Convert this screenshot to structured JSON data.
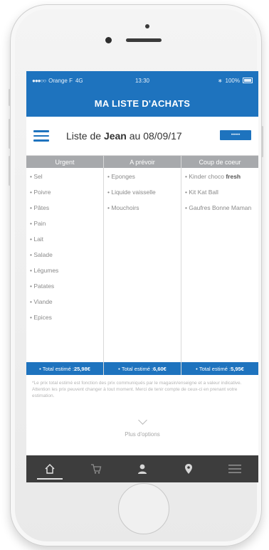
{
  "status": {
    "carrier": "Orange F",
    "network": "4G",
    "time": "13:30",
    "battery": "100%"
  },
  "app": {
    "title": "MA LISTE D'ACHATS"
  },
  "header": {
    "title_prefix": "Liste de ",
    "owner": "Jean",
    "title_suffix": " au 08/09/17",
    "chip_label": "••••••"
  },
  "columns": [
    {
      "heading": "Urgent",
      "items": [
        "Sel",
        "Poivre",
        "Pâtes",
        "Pain",
        "Lait",
        "Salade",
        "Légumes",
        "Patates",
        "Viande",
        "Epices"
      ],
      "total_label": "Total estimé : ",
      "total_value": "25,98€"
    },
    {
      "heading": "A prévoir",
      "items": [
        "Eponges",
        "Liquide vaisselle",
        "Mouchoirs"
      ],
      "total_label": "Total estimé : ",
      "total_value": "6,60€"
    },
    {
      "heading": "Coup de coeur",
      "items": [
        {
          "text": "Kinder choco ",
          "bold": "fresh"
        },
        {
          "text": "Kit Kat Ball",
          "bold": ""
        },
        {
          "text": "Gaufres Bonne Maman",
          "bold": ""
        }
      ],
      "total_label": "Total estimé : ",
      "total_value": "5,95€"
    }
  ],
  "note": "*Le prix total estimé est fonction des prix communiqués par le magasin/enseigne et a valeur indicative. Attention les prix peuvent changer à tout moment. Merci de tenir compte de ceux-ci en prenant votre estimation.",
  "more": {
    "label": "Plus d'options"
  },
  "tabs": [
    {
      "name": "home-icon"
    },
    {
      "name": "cart-icon"
    },
    {
      "name": "user-icon"
    },
    {
      "name": "location-pin-icon"
    },
    {
      "name": "menu-icon"
    }
  ],
  "colors": {
    "primary": "#1e73be",
    "column_header": "#a7a9ac",
    "tabbar": "#3d3d3d"
  }
}
